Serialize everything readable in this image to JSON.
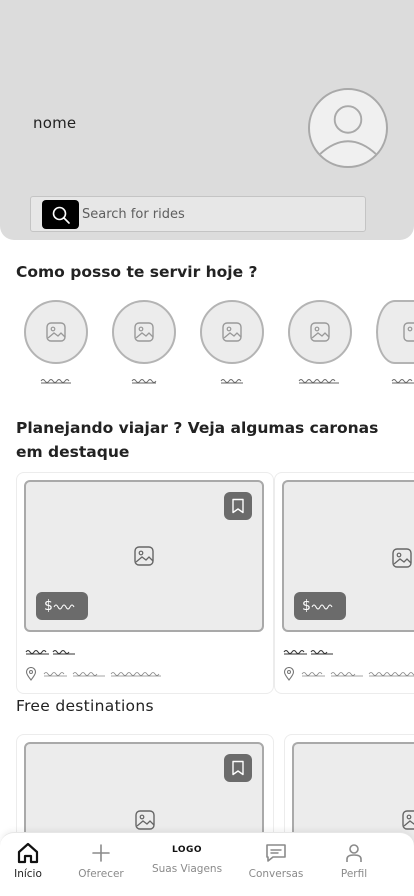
{
  "header": {
    "username": "nome",
    "search_placeholder": "Search for rides"
  },
  "sections": {
    "services_title": "Como posso te servir hoje ?",
    "featured_title": "Planejando viajar ? Veja algumas caronas em destaque",
    "free_title": "Free destinations"
  },
  "featured_cards": [
    {
      "price_symbol": "$"
    },
    {
      "price_symbol": "$"
    }
  ],
  "nav": {
    "home_label": "Início",
    "offer_label": "Oferecer",
    "logo": "LOGO",
    "trips_label": "Suas Viagens",
    "chats_label": "Conversas",
    "profile_label": "Perfil"
  },
  "colors": {
    "header_bg": "#dcdcdc",
    "badge_bg": "#6b6b6b",
    "search_button": "#000000"
  }
}
